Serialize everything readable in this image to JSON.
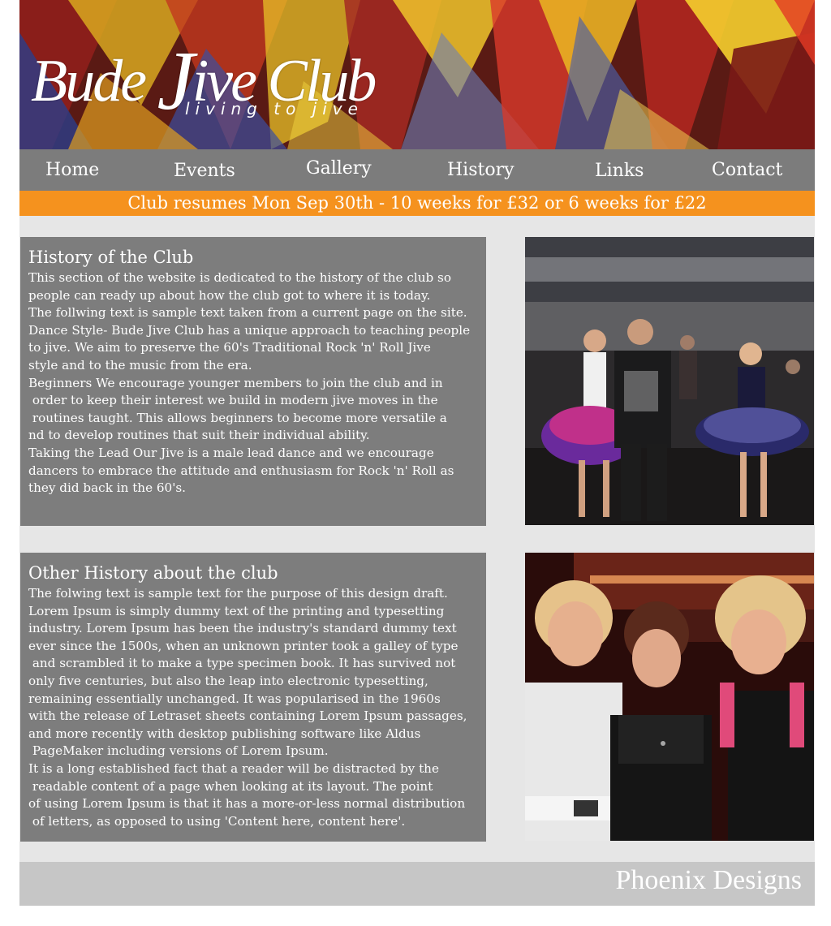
{
  "site": {
    "logo_title_prefix": "Bude ",
    "logo_title_j": "J",
    "logo_title_suffix": "ive Club",
    "tagline": "living to jive"
  },
  "nav": {
    "items": [
      {
        "label": "Home"
      },
      {
        "label": "Events"
      },
      {
        "label": "Gallery"
      },
      {
        "label": "History"
      },
      {
        "label": "Links"
      },
      {
        "label": "Contact"
      }
    ]
  },
  "announcement": "Club resumes Mon Sep 30th - 10 weeks for £32 or 6 weeks for £22",
  "sections": [
    {
      "title": "History of the Club",
      "body": "This section of the website is dedicated to the history of the club so\npeople can ready up about how the club got to where it is today.\nThe follwing text is sample text taken from a current page on the site.\nDance Style- Bude Jive Club has a unique approach to teaching people\nto jive. We aim to preserve the 60's Traditional Rock 'n' Roll Jive\nstyle and to the music from the era.\nBeginners We encourage younger members to join the club and in\n order to keep their interest we build in modern jive moves in the\n routines taught. This allows beginners to become more versatile a\nnd to develop routines that suit their individual ability.\nTaking the Lead Our Jive is a male lead dance and we encourage\ndancers to embrace the attitude and enthusiasm for Rock 'n' Roll as\nthey did back in the 60's."
    },
    {
      "title": "Other History about the club",
      "body": "The folwing text is sample text for the purpose of this design draft.\nLorem Ipsum is simply dummy text of the printing and typesetting\nindustry. Lorem Ipsum has been the industry's standard dummy text\never since the 1500s, when an unknown printer took a galley of type\n and scrambled it to make a type specimen book. It has survived not\nonly five centuries, but also the leap into electronic typesetting,\nremaining essentially unchanged. It was popularised in the 1960s\nwith the release of Letraset sheets containing Lorem Ipsum passages,\nand more recently with desktop publishing software like Aldus\n PageMaker including versions of Lorem Ipsum.\nIt is a long established fact that a reader will be distracted by the\n readable content of a page when looking at its layout. The point\nof using Lorem Ipsum is that it has a more-or-less normal distribution\n of letters, as opposed to using 'Content here, content here'."
    }
  ],
  "footer": {
    "text": "Phoenix Designs"
  },
  "colors": {
    "nav_bg": "#7c7c7c",
    "announce_bg": "#f5921e",
    "section_bg": "#7d7d7d",
    "page_bg": "#e6e6e6",
    "footer_bg": "#c6c6c6"
  }
}
